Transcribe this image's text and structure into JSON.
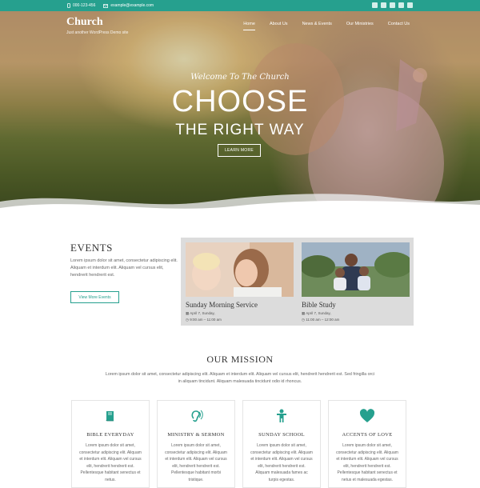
{
  "topbar": {
    "phone": "000-123-456",
    "email": "example@example.com",
    "social_icons": [
      "twitter-icon",
      "facebook-icon",
      "linkedin-icon",
      "youtube-icon",
      "instagram-icon"
    ]
  },
  "brand": {
    "name": "Church",
    "tagline": "Just another WordPress Demo site"
  },
  "nav": [
    "Home",
    "About Us",
    "News & Events",
    "Our Ministries",
    "Contact Us"
  ],
  "hero": {
    "welcome": "Welcome To The Church",
    "headline": "CHOOSE",
    "subheadline": "THE RIGHT WAY",
    "button": "LEARN MORE"
  },
  "events": {
    "title": "EVENTS",
    "description": "Lorem ipsum dolor sit amet, consectetur adipiscing elit. Aliquam et interdum elit. Aliquam vel cursus elit, hendrerit hendrerit est.",
    "button": "View More Events",
    "items": [
      {
        "title": "Sunday Morning Service",
        "date": "April 7, Sunday,",
        "time": "9:00 am – 11:00 am"
      },
      {
        "title": "Bible Study",
        "date": "April 7, Sunday,",
        "time": "11:00 am – 12:00 am"
      }
    ]
  },
  "mission": {
    "title": "OUR MISSION",
    "description": "Lorem ipsum dolor sit amet, consectetur adipiscing elit. Aliquam et interdum elit. Aliquam vel cursus elit, hendrerit hendrerit est. Sed fringilla orci in aliquam tincidunt. Aliquam malesuada tincidunt odio id rhoncus.",
    "cards": [
      {
        "title": "BIBLE EVERYDAY",
        "icon": "book-icon",
        "text": "Lorem ipsum dolor sit amet, consectetur adipiscing elit. Aliquam et interdum elit. Aliquam vel cursus elit, hendrerit hendrerit est. Pellentesque habitant senectus et netus."
      },
      {
        "title": "MINISTRY & SERMON",
        "icon": "hearing-icon",
        "text": "Lorem ipsum dolor sit amet, consectetur adipiscing elit. Aliquam et interdum elit. Aliquam vel cursus elit, hendrerit hendrerit est. Pellentesque habitant morbi tristique."
      },
      {
        "title": "SUNDAY SCHOOL",
        "icon": "child-icon",
        "text": "Lorem ipsum dolor sit amet, consectetur adipiscing elit. Aliquam et interdum elit. Aliquam vel cursus elit, hendrerit hendrerit est. Aliquam malesuada fames ac turpis egestas."
      },
      {
        "title": "ACCENTS OF LOVE",
        "icon": "heart-icon",
        "text": "Lorem ipsum dolor sit amet, consectetur adipiscing elit. Aliquam et interdum elit. Aliquam vel cursus elit, hendrerit hendrerit est. Pellentesque habitant senectus et netus et malesuada egestas."
      }
    ]
  },
  "colors": {
    "accent": "#26a08e"
  }
}
